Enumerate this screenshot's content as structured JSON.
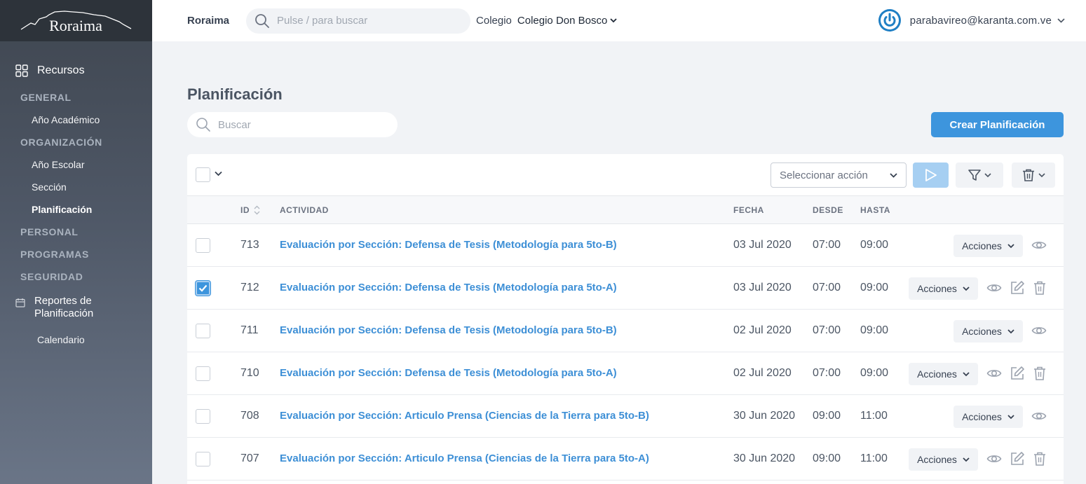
{
  "brand": {
    "name": "Roraima"
  },
  "sidebar": {
    "resources_label": "Recursos",
    "sections": {
      "general": "GENERAL",
      "anio_academico": "Año Académico",
      "organizacion": "ORGANIZACIÓN",
      "anio_escolar": "Año Escolar",
      "seccion": "Sección",
      "planificacion": "Planificación",
      "personal": "PERSONAL",
      "programas": "PROGRAMAS",
      "seguridad": "SEGURIDAD"
    },
    "reportes_line1": "Reportes de",
    "reportes_line2": "Planificación",
    "calendario": "Calendario"
  },
  "topbar": {
    "app_name": "Roraima",
    "search_placeholder": "Pulse / para buscar",
    "colegio_label": "Colegio",
    "colegio_value": "Colegio Don Bosco",
    "user_email": "parabavireo@karanta.com.ve"
  },
  "page": {
    "title": "Planificación",
    "search_placeholder": "Buscar",
    "create_button": "Crear Planificación",
    "select_action_placeholder": "Seleccionar acción"
  },
  "table": {
    "headers": {
      "id": "ID",
      "actividad": "ACTIVIDAD",
      "fecha": "FECHA",
      "desde": "DESDE",
      "hasta": "HASTA"
    },
    "acciones_label": "Acciones",
    "rows": [
      {
        "id": "713",
        "actividad": "Evaluación por Sección: Defensa de Tesis (Metodología para 5to-B)",
        "fecha": "03 Jul 2020",
        "desde": "07:00",
        "hasta": "09:00",
        "checked": false,
        "editable": false
      },
      {
        "id": "712",
        "actividad": "Evaluación por Sección: Defensa de Tesis (Metodología para 5to-A)",
        "fecha": "03 Jul 2020",
        "desde": "07:00",
        "hasta": "09:00",
        "checked": true,
        "editable": true
      },
      {
        "id": "711",
        "actividad": "Evaluación por Sección: Defensa de Tesis (Metodología para 5to-B)",
        "fecha": "02 Jul 2020",
        "desde": "07:00",
        "hasta": "09:00",
        "checked": false,
        "editable": false
      },
      {
        "id": "710",
        "actividad": "Evaluación por Sección: Defensa de Tesis (Metodología para 5to-A)",
        "fecha": "02 Jul 2020",
        "desde": "07:00",
        "hasta": "09:00",
        "checked": false,
        "editable": true
      },
      {
        "id": "708",
        "actividad": "Evaluación por Sección: Articulo Prensa (Ciencias de la Tierra para 5to-B)",
        "fecha": "30 Jun 2020",
        "desde": "09:00",
        "hasta": "11:00",
        "checked": false,
        "editable": false
      },
      {
        "id": "707",
        "actividad": "Evaluación por Sección: Articulo Prensa (Ciencias de la Tierra para 5to-A)",
        "fecha": "30 Jun 2020",
        "desde": "09:00",
        "hasta": "11:00",
        "checked": false,
        "editable": true
      }
    ]
  },
  "colors": {
    "accent": "#3d95dd",
    "link": "#3d8fd6",
    "sidebar_top": "#2d333a"
  },
  "icons": [
    "grid-icon",
    "calendar-icon",
    "search-icon",
    "power-icon",
    "chevron-down-icon",
    "play-icon",
    "filter-icon",
    "trash-icon",
    "eye-icon",
    "edit-icon",
    "sort-icon",
    "check-icon"
  ]
}
